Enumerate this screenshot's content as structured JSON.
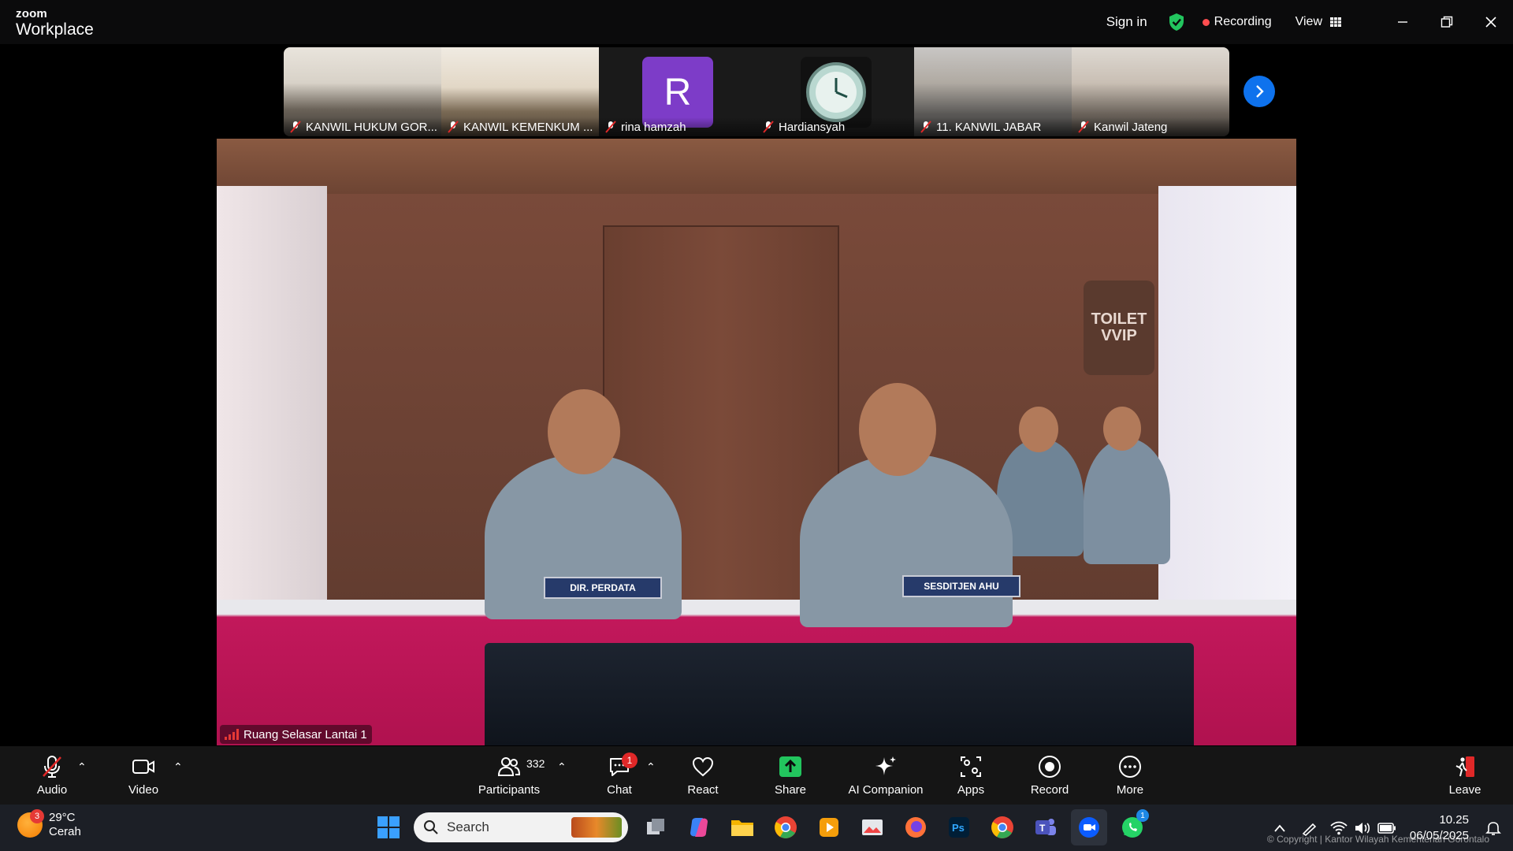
{
  "app": {
    "brand_top": "zoom",
    "brand_bottom": "Workplace"
  },
  "titlebar": {
    "sign_in": "Sign in",
    "recording": "Recording",
    "view": "View"
  },
  "thumbnails": [
    {
      "name": "KANWIL HUKUM GOR..."
    },
    {
      "name": "KANWIL KEMENKUM ..."
    },
    {
      "name": "rina hamzah",
      "initial": "R"
    },
    {
      "name": "Hardiansyah"
    },
    {
      "name": "11. KANWIL JABAR"
    },
    {
      "name": "Kanwil Jateng"
    }
  ],
  "main_video": {
    "speaker_label": "Ruang Selasar Lantai 1",
    "nameplate_left": "DIR. PERDATA",
    "nameplate_right": "SESDITJEN AHU",
    "sign_line1": "TOILET",
    "sign_line2": "VVIP"
  },
  "toolbar": {
    "audio": "Audio",
    "video": "Video",
    "participants": "Participants",
    "participants_count": "332",
    "chat": "Chat",
    "chat_badge": "1",
    "react": "React",
    "share": "Share",
    "ai_companion": "AI Companion",
    "apps": "Apps",
    "record": "Record",
    "more": "More",
    "leave": "Leave"
  },
  "taskbar": {
    "weather_temp": "29°C",
    "weather_desc": "Cerah",
    "weather_badge": "3",
    "search_placeholder": "Search",
    "whatsapp_badge": "1",
    "time": "10.25",
    "date": "06/05/2025",
    "copyright": "© Copyright | Kantor Wilayah Kementerian Gorontalo"
  },
  "colors": {
    "accent": "#0e72ed",
    "recording": "#ff4d4f",
    "share": "#22c55e",
    "leave": "#e02828"
  }
}
